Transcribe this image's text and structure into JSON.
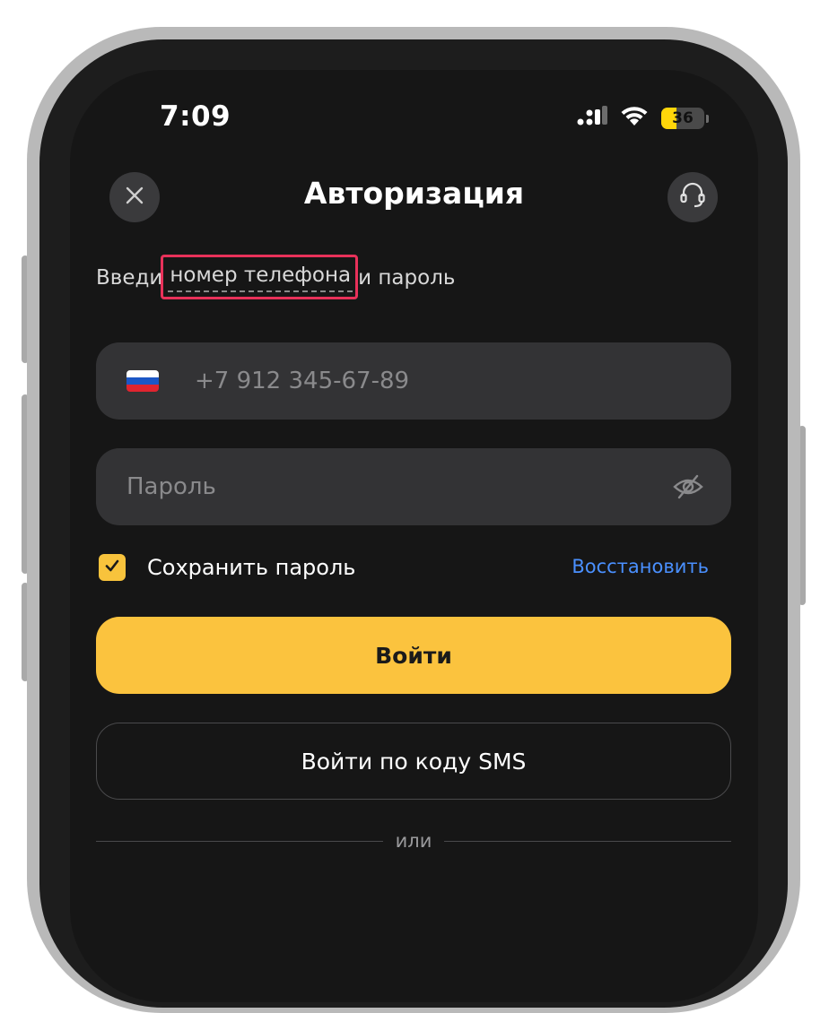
{
  "status_bar": {
    "time": "7:09",
    "signal_icon": "cellular-signal-icon",
    "wifi_icon": "wifi-icon",
    "battery_level": "36",
    "battery_fraction": 0.36,
    "battery_color": "#ffd60a"
  },
  "header": {
    "title": "Авторизация",
    "close_icon": "close-icon",
    "support_icon": "headset-icon"
  },
  "subtitle": {
    "prefix": "Введи",
    "link": "номер телефона",
    "suffix": "и пароль"
  },
  "phone_field": {
    "country_flag": "russia-flag-icon",
    "placeholder": "+7 912 345-67-89",
    "value": ""
  },
  "password_field": {
    "placeholder": "Пароль",
    "value": "",
    "toggle_icon": "eye-off-icon"
  },
  "remember": {
    "label": "Сохранить пароль",
    "checked": true
  },
  "restore_link": "Восстановить",
  "buttons": {
    "login": "Войти",
    "sms_login": "Войти по коду SMS"
  },
  "divider_text": "или",
  "colors": {
    "accent": "#fbc33e",
    "link": "#4a90ff",
    "highlight": "#e8315a",
    "background": "#161616",
    "field": "#333335"
  }
}
